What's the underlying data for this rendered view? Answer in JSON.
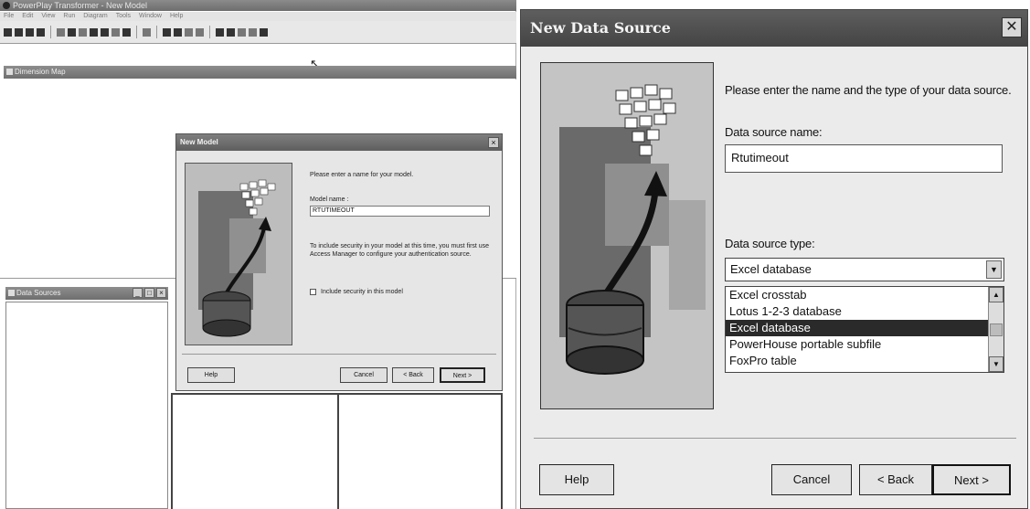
{
  "left_window": {
    "title": "PowerPlay Transformer - New Model",
    "menu": [
      "File",
      "Edit",
      "View",
      "Run",
      "Diagram",
      "Tools",
      "Window",
      "Help"
    ],
    "dimension_map_title": "Dimension Map",
    "data_sources_title": "Data Sources",
    "toolbar_icons": [
      "new-icon",
      "open-icon",
      "save-icon",
      "print-icon",
      "undo-icon",
      "add-icon",
      "remove-icon",
      "table-icon",
      "copy-icon",
      "find-icon",
      "zoom-icon",
      "help-icon",
      "chart-icon",
      "lock-icon",
      "grid-icon",
      "cube-icon",
      "globe-icon",
      "settings-icon",
      "info-icon",
      "whats-this-icon"
    ]
  },
  "new_model_dialog": {
    "title": "New Model",
    "prompt": "Please enter a name for your model.",
    "model_name_label": "Model name :",
    "model_name_value": "RTUTIMEOUT",
    "security_info": "To include security in your model at this time, you must first use Access Manager to configure your authentication source.",
    "security_checkbox_label": "Include security in this model",
    "help_label": "Help",
    "cancel_label": "Cancel",
    "back_label": "< Back",
    "next_label": "Next >"
  },
  "new_data_source_dialog": {
    "title": "New Data Source",
    "close_symbol": "✕",
    "prompt": "Please enter the name and the type of your data source.",
    "name_label": "Data source name:",
    "name_value": "Rtutimeout",
    "type_label": "Data source type:",
    "type_selected": "Excel database",
    "type_options": [
      {
        "label": "Excel crosstab",
        "selected": false
      },
      {
        "label": "Lotus 1-2-3 database",
        "selected": false
      },
      {
        "label": "Excel database",
        "selected": true
      },
      {
        "label": "PowerHouse portable subfile",
        "selected": false
      },
      {
        "label": "FoxPro table",
        "selected": false
      }
    ],
    "help_label": "Help",
    "cancel_label": "Cancel",
    "back_label": "< Back",
    "next_label": "Next >"
  }
}
